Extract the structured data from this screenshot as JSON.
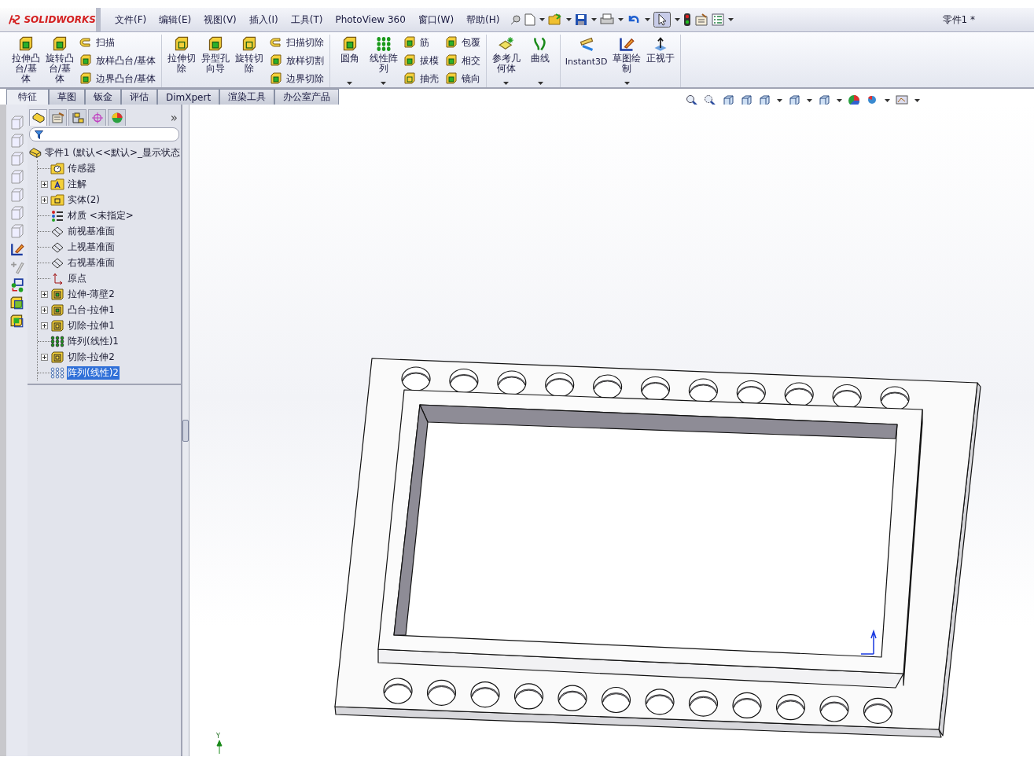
{
  "window": {
    "title": "零件1 *"
  },
  "logo": {
    "text": "SOLIDWORKS"
  },
  "menu": [
    {
      "label": "文件(F)"
    },
    {
      "label": "编辑(E)"
    },
    {
      "label": "视图(V)"
    },
    {
      "label": "插入(I)"
    },
    {
      "label": "工具(T)"
    },
    {
      "label": "PhotoView 360"
    },
    {
      "label": "窗口(W)"
    },
    {
      "label": "帮助(H)"
    }
  ],
  "ribbon": {
    "groups": [
      {
        "columns": [
          [
            {
              "kind": "large",
              "label": "拉伸凸台/基体",
              "dropdown": false
            }
          ],
          [
            {
              "kind": "large",
              "label": "旋转凸台/基体",
              "dropdown": false
            }
          ],
          [
            {
              "kind": "small",
              "label": "扫描"
            },
            {
              "kind": "small",
              "label": "放样凸台/基体"
            },
            {
              "kind": "small",
              "label": "边界凸台/基体"
            }
          ]
        ]
      },
      {
        "columns": [
          [
            {
              "kind": "large",
              "label": "拉伸切除",
              "dropdown": false
            }
          ],
          [
            {
              "kind": "large",
              "label": "异型孔向导",
              "dropdown": false
            }
          ],
          [
            {
              "kind": "large",
              "label": "旋转切除",
              "dropdown": false
            }
          ],
          [
            {
              "kind": "small",
              "label": "扫描切除"
            },
            {
              "kind": "small",
              "label": "放样切割"
            },
            {
              "kind": "small",
              "label": "边界切除"
            }
          ]
        ]
      },
      {
        "columns": [
          [
            {
              "kind": "large",
              "label": "圆角",
              "dropdown": true
            }
          ],
          [
            {
              "kind": "large",
              "label": "线性阵列",
              "dropdown": true
            }
          ],
          [
            {
              "kind": "small",
              "label": "筋"
            },
            {
              "kind": "small",
              "label": "拔模"
            },
            {
              "kind": "small",
              "label": "抽壳"
            }
          ],
          [
            {
              "kind": "small",
              "label": "包覆"
            },
            {
              "kind": "small",
              "label": "相交"
            },
            {
              "kind": "small",
              "label": "镜向"
            }
          ]
        ]
      },
      {
        "columns": [
          [
            {
              "kind": "large",
              "label": "参考几何体",
              "dropdown": true
            }
          ],
          [
            {
              "kind": "large",
              "label": "曲线",
              "dropdown": true
            }
          ]
        ]
      },
      {
        "columns": [
          [
            {
              "kind": "wide",
              "label": "Instant3D",
              "dropdown": false
            }
          ],
          [
            {
              "kind": "large",
              "label": "草图绘制",
              "dropdown": true
            }
          ],
          [
            {
              "kind": "large",
              "label": "正视于",
              "dropdown": false
            }
          ]
        ]
      }
    ]
  },
  "command_tabs": [
    {
      "label": "特征",
      "selected": true
    },
    {
      "label": "草图",
      "selected": false
    },
    {
      "label": "钣金",
      "selected": false
    },
    {
      "label": "评估",
      "selected": false
    },
    {
      "label": "DimXpert",
      "selected": false
    },
    {
      "label": "渲染工具",
      "selected": false
    },
    {
      "label": "办公室产品",
      "selected": false
    }
  ],
  "panel_tabs": [
    {
      "selected": true
    },
    {
      "selected": false
    },
    {
      "selected": false
    },
    {
      "selected": false
    },
    {
      "selected": false
    }
  ],
  "panel_more": "»",
  "tree": {
    "label": "零件1  (默认<<默认>_显示状态",
    "children": [
      {
        "label": "传感器",
        "selected": false
      },
      {
        "label": "注解",
        "selected": false,
        "expanded": false
      },
      {
        "label": "实体(2)",
        "selected": false,
        "expanded": false
      },
      {
        "label": "材质 <未指定>",
        "selected": false
      },
      {
        "label": "前视基准面",
        "selected": false
      },
      {
        "label": "上视基准面",
        "selected": false
      },
      {
        "label": "右视基准面",
        "selected": false
      },
      {
        "label": "原点",
        "selected": false
      },
      {
        "label": "拉伸-薄壁2",
        "selected": false,
        "expanded": false
      },
      {
        "label": "凸台-拉伸1",
        "selected": false,
        "expanded": false
      },
      {
        "label": "切除-拉伸1",
        "selected": false,
        "expanded": false
      },
      {
        "label": "阵列(线性)1",
        "selected": false
      },
      {
        "label": "切除-拉伸2",
        "selected": false,
        "expanded": false
      },
      {
        "label": "阵列(线性)2",
        "selected": true
      }
    ]
  },
  "triad": {
    "label": "Y"
  }
}
